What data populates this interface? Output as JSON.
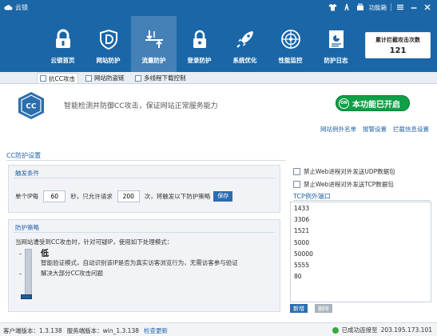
{
  "app": {
    "title": "云锁"
  },
  "titlebar": {
    "function_box_label": "功能箱"
  },
  "nav": {
    "items": [
      {
        "label": "云锁首页",
        "icon": "lock-icon"
      },
      {
        "label": "网站防护",
        "icon": "shield-d-icon"
      },
      {
        "label": "流量防护",
        "icon": "traffic-icon"
      },
      {
        "label": "登录防护",
        "icon": "login-lock-icon"
      },
      {
        "label": "系统优化",
        "icon": "rocket-icon"
      },
      {
        "label": "性能监控",
        "icon": "radar-icon"
      },
      {
        "label": "防护日志",
        "icon": "log-icon"
      }
    ],
    "active_index": 2
  },
  "counter": {
    "title": "累计拦截攻击次数",
    "value": "121"
  },
  "subtabs": [
    "抗CC攻击",
    "网站防盗链",
    "多线程下载控制"
  ],
  "feature": {
    "description": "智能检测并防御CC攻击，保证网站正常服务能力",
    "toggle_label": "本功能已开启",
    "toggle_knob": "ON"
  },
  "links": [
    "网站例外名单",
    "报警设置",
    "拦截信息设置"
  ],
  "cc": {
    "section_title": "CC防护设置",
    "trigger": {
      "title": "触发条件",
      "prefix": "单个IP每",
      "seconds": "60",
      "mid": "秒，只允许请求",
      "requests": "200",
      "suffix": "次，将触发以下防护策略",
      "save_label": "保存"
    },
    "policy": {
      "title": "防护策略",
      "description": "当网站遭受到CC攻击时，针对可疑IP，使用如下处理模式：",
      "level": "低",
      "level_desc_1": "智能验证模式，自动识别该IP是否为真实访客浏览行为，无需访客参与验证",
      "level_desc_2": "解决大部分CC攻击问题"
    }
  },
  "options": {
    "disable_udp": "禁止Web进程对外发送UDP数据包",
    "disable_tcp": "禁止Web进程对外发送TCP数据包"
  },
  "ports": {
    "title": "TCP例外端口",
    "list": [
      "1433",
      "3306",
      "1521",
      "5000",
      "50000",
      "5555",
      "80"
    ],
    "add_label": "新增",
    "delete_label": "删除"
  },
  "status": {
    "client_version_label": "客户端版本：",
    "client_version": "1.3.138",
    "server_version_label": "服务端版本：",
    "server_version": "win_1.3.138",
    "check_update": "检查更新",
    "connected_label": "已成功连接至",
    "server_ip": "203.195.173.101"
  }
}
